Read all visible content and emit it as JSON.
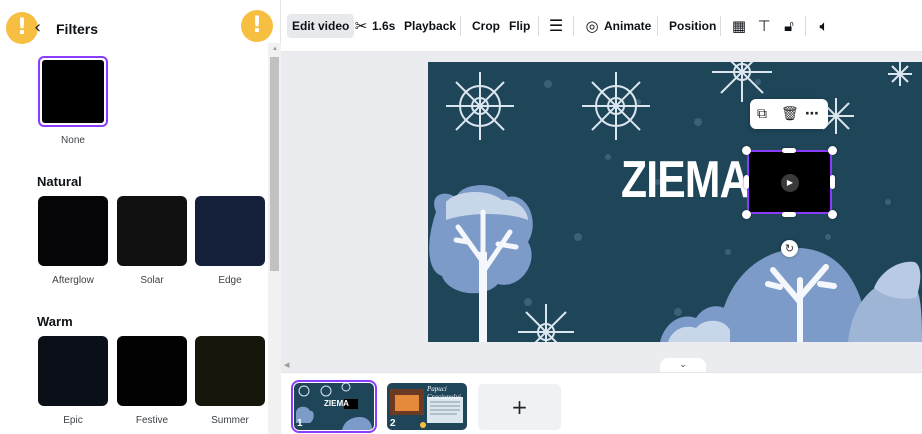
{
  "panel": {
    "back_icon": "chevron-left-icon",
    "title": "Filters",
    "none_label": "None",
    "sections": [
      {
        "heading": "Natural",
        "filters": [
          {
            "label": "Afterglow",
            "color": "#050507"
          },
          {
            "label": "Solar",
            "color": "#111111"
          },
          {
            "label": "Edge",
            "color": "#14203a"
          }
        ]
      },
      {
        "heading": "Warm",
        "filters": [
          {
            "label": "Epic",
            "color": "#0b0f18"
          },
          {
            "label": "Festive",
            "color": "#020202"
          },
          {
            "label": "Summer",
            "color": "#17160a"
          }
        ]
      }
    ]
  },
  "toolbar": {
    "edit_video_label": "Edit video",
    "trim_icon": "scissors-icon",
    "duration": "1.6s",
    "playback_label": "Playback",
    "crop_label": "Crop",
    "flip_label": "Flip",
    "border_icon": "border-style-icon",
    "animate_icon": "animate-icon",
    "animate_label": "Animate",
    "position_label": "Position",
    "transparency_icon": "transparency-icon",
    "paint_icon": "paint-roller-icon",
    "lock_icon": "lock-icon",
    "volume_icon": "volume-icon"
  },
  "canvas": {
    "slide_title": "ZIEMA",
    "background_color": "#1f4559",
    "selection_color": "#8b3dff",
    "float_actions": [
      "duplicate-icon",
      "trash-icon",
      "more-icon"
    ]
  },
  "pages": {
    "thumbnails": [
      {
        "number": "1",
        "text": "ZIEMA"
      },
      {
        "number": "2",
        "title": "Papuci Craciunului"
      }
    ],
    "add_label": "+"
  },
  "colors": {
    "accent": "#8b3dff",
    "warning": "#f6bf42"
  }
}
